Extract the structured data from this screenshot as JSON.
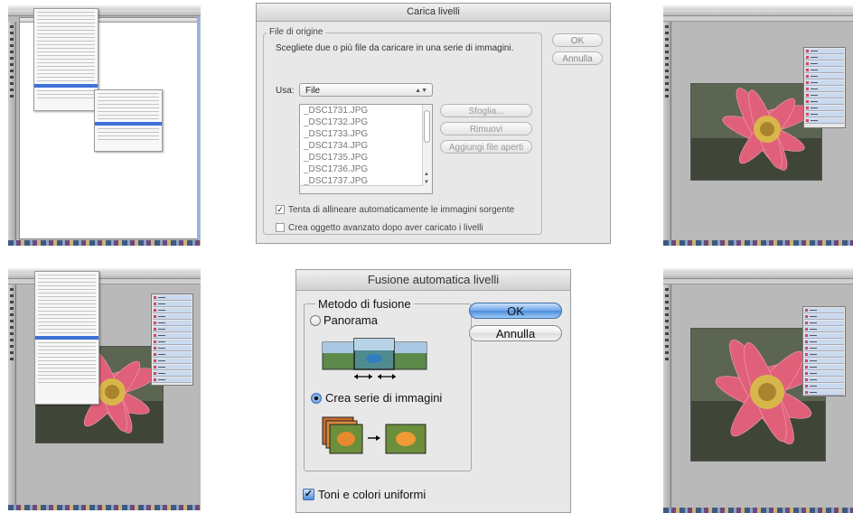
{
  "carica_livelli": {
    "title": "Carica livelli",
    "group_label": "File di origine",
    "description": "Scegliete due o più file da caricare in una serie di immagini.",
    "use_label": "Usa:",
    "use_value": "File",
    "files": [
      "_DSC1731.JPG",
      "_DSC1732.JPG",
      "_DSC1733.JPG",
      "_DSC1734.JPG",
      "_DSC1735.JPG",
      "_DSC1736.JPG",
      "_DSC1737.JPG"
    ],
    "browse_label": "Sfoglia...",
    "remove_label": "Rimuovi",
    "add_open_label": "Aggiungi file aperti",
    "ok_label": "OK",
    "cancel_label": "Annulla",
    "auto_align_label": "Tenta di allineare automaticamente le immagini sorgente",
    "auto_align_checked": true,
    "smart_object_label": "Crea oggetto avanzato dopo aver caricato i livelli",
    "smart_object_checked": false
  },
  "fusione_automatica": {
    "title": "Fusione automatica livelli",
    "group_label": "Metodo di fusione",
    "panorama_label": "Panorama",
    "stack_label": "Crea serie di immagini",
    "selected_method": "stack",
    "ok_label": "OK",
    "cancel_label": "Annulla",
    "seamless_label": "Toni e colori uniformi",
    "seamless_checked": true
  },
  "colors": {
    "accent_blue": "#4a8ddf",
    "flower_pink": "#e0607a"
  }
}
